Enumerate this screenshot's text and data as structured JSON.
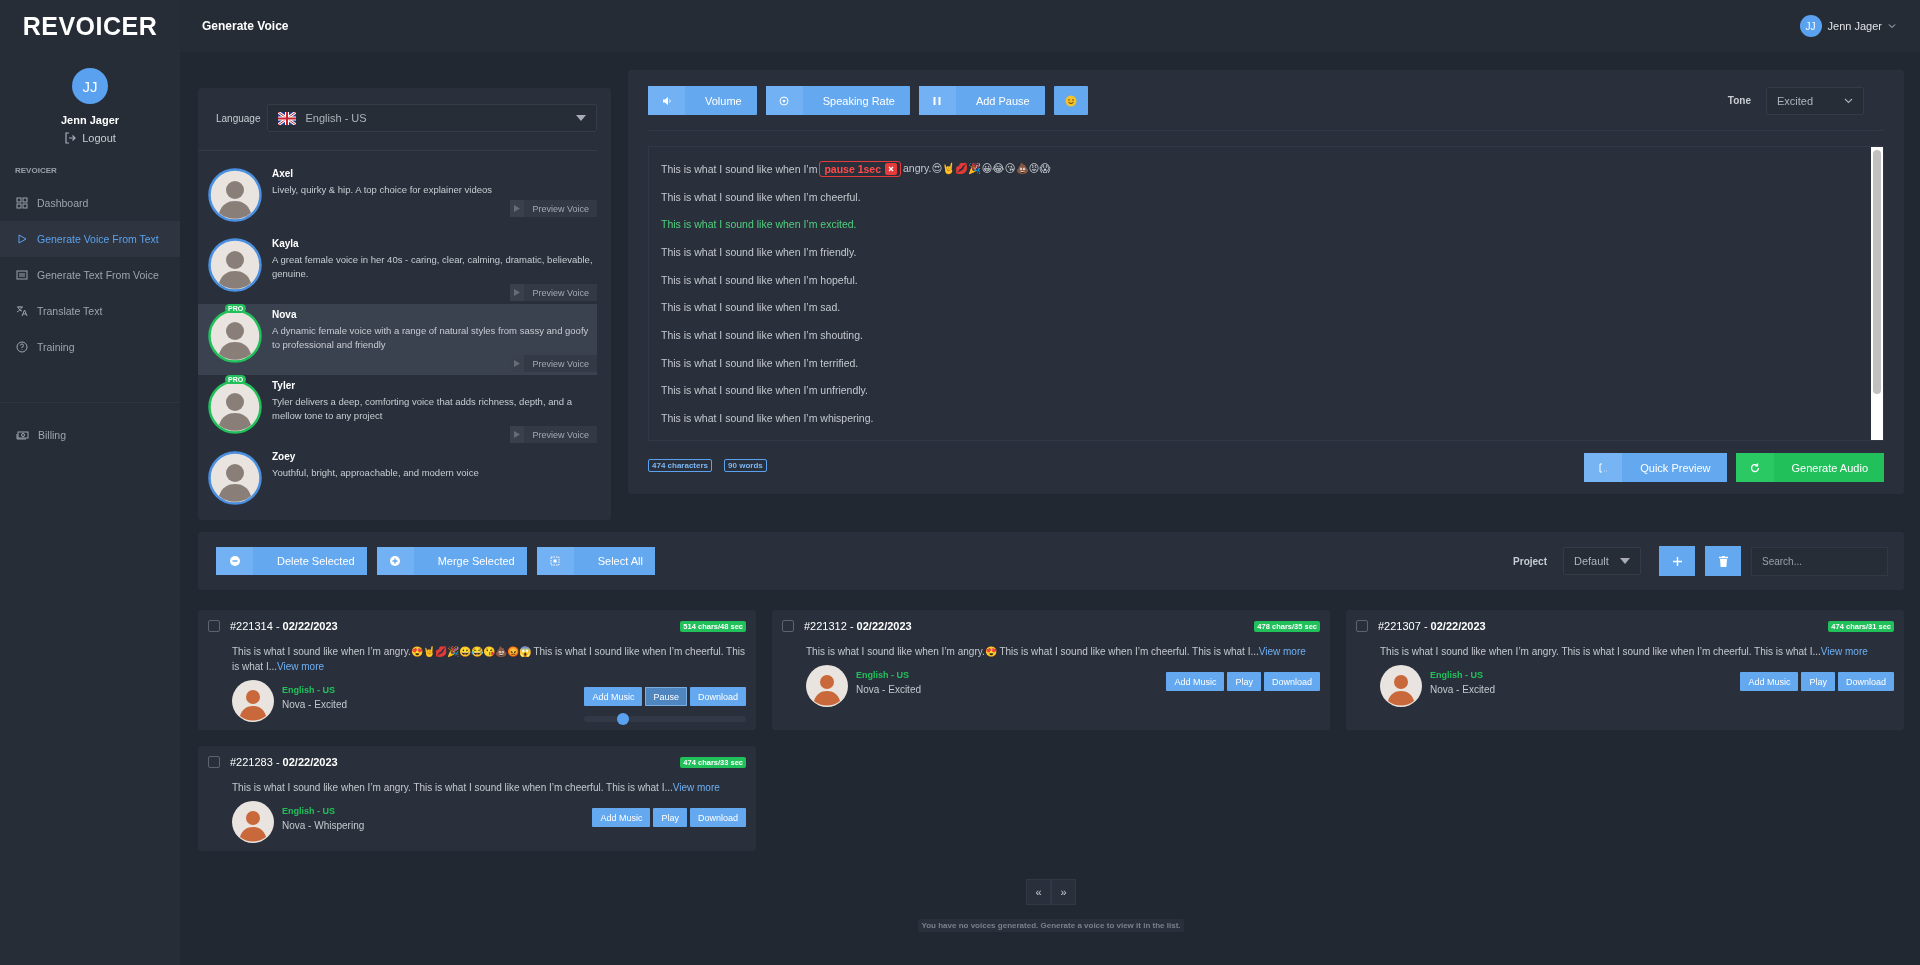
{
  "logo": "REVOICER",
  "header": {
    "title": "Generate Voice",
    "user": {
      "initials": "JJ",
      "name": "Jenn Jager"
    }
  },
  "sidebar": {
    "profile": {
      "initials": "JJ",
      "name": "Jenn Jager",
      "logout": "Logout"
    },
    "section": "REVOICER",
    "items": [
      {
        "label": "Dashboard",
        "selected": false
      },
      {
        "label": "Generate Voice From Text",
        "selected": true
      },
      {
        "label": "Generate Text From Voice",
        "selected": false
      },
      {
        "label": "Translate Text",
        "selected": false
      },
      {
        "label": "Training",
        "selected": false
      },
      {
        "label": "Billing",
        "selected": false
      }
    ]
  },
  "voices_panel": {
    "language_label": "Language",
    "language": "English - US",
    "voices": [
      {
        "name": "Axel",
        "description": "Lively, quirky & hip. A top choice for explainer videos",
        "selected": false,
        "preview": "Preview Voice"
      },
      {
        "name": "Kayla",
        "description": "A great female voice in her 40s - caring, clear, calming, dramatic, believable, genuine.",
        "selected": false,
        "preview": "Preview Voice"
      },
      {
        "name": "Nova",
        "description": "A dynamic female voice with a range of natural styles from sassy and goofy to professional and friendly",
        "badge": "PRO",
        "selected": true,
        "preview": "Preview Voice"
      },
      {
        "name": "Tyler",
        "description": "Tyler delivers a deep, comforting voice that adds richness, depth, and a mellow tone to any project",
        "badge": "PRO",
        "selected": false,
        "preview": "Preview Voice"
      },
      {
        "name": "Zoey",
        "description": "Youthful, bright, approachable, and modern voice",
        "selected": false
      }
    ]
  },
  "editor": {
    "toolbar": [
      "Volume",
      "Speaking Rate",
      "Add Pause"
    ],
    "tone_label": "Tone",
    "tone": "Excited",
    "lines": [
      {
        "highlighted": false,
        "parts": [
          {
            "kind": "text",
            "text": "This is what I sound like when I’m"
          },
          {
            "kind": "pause",
            "text": "pause 1sec"
          },
          {
            "kind": "text",
            "text": "angry.😍🤘💋🎉😀😂😘💩😡😱"
          }
        ]
      },
      {
        "highlighted": false,
        "parts": [
          {
            "kind": "text",
            "text": "This is what I sound like when I’m cheerful."
          }
        ]
      },
      {
        "highlighted": true,
        "parts": [
          {
            "kind": "text",
            "text": "This is what I sound like when I’m excited."
          }
        ]
      },
      {
        "highlighted": false,
        "parts": [
          {
            "kind": "text",
            "text": "This is what I sound like when I’m friendly."
          }
        ]
      },
      {
        "highlighted": false,
        "parts": [
          {
            "kind": "text",
            "text": "This is what I sound like when I’m hopeful."
          }
        ]
      },
      {
        "highlighted": false,
        "parts": [
          {
            "kind": "text",
            "text": "This is what I sound like when I’m sad."
          }
        ]
      },
      {
        "highlighted": false,
        "parts": [
          {
            "kind": "text",
            "text": "This is what I sound like when I’m shouting."
          }
        ]
      },
      {
        "highlighted": false,
        "parts": [
          {
            "kind": "text",
            "text": "This is what I sound like when I’m terrified."
          }
        ]
      },
      {
        "highlighted": false,
        "parts": [
          {
            "kind": "text",
            "text": "This is what I sound like when I’m unfriendly."
          }
        ]
      },
      {
        "highlighted": false,
        "parts": [
          {
            "kind": "text",
            "text": "This is what I sound like when I’m whispering."
          }
        ]
      }
    ],
    "characters": "474 characters",
    "words": "90 words",
    "quick_preview": "Quick Preview",
    "generate": "Generate Audio"
  },
  "actions": {
    "delete": "Delete Selected",
    "merge": "Merge Selected",
    "select_all": "Select All",
    "project_label": "Project",
    "project": "Default",
    "search": {
      "placeholder": "Search..."
    }
  },
  "cards": [
    {
      "title": "#221314 - **02/22/2023**",
      "badge": "514 chars/48 sec",
      "checked": false,
      "text": "This is what I sound like when I’m angry.😍🤘💋🎉😀😂😘💩😡😱 This is what I sound like when I’m cheerful. This is what I...",
      "more": "View more",
      "language": "English - US",
      "voice": "Nova - Excited",
      "buttons": [
        {
          "label": "Add Music",
          "pressed": false
        },
        {
          "label": "Pause",
          "pressed": true
        },
        {
          "label": "Download",
          "pressed": false
        }
      ],
      "player": {
        "level": 0.24
      }
    },
    {
      "title": "#221312 - **02/22/2023**",
      "badge": "478 chars/35 sec",
      "checked": false,
      "text": "This is what I sound like when I’m angry.😍 This is what I sound like when I’m cheerful. This is what I...",
      "more": "View more",
      "language": "English - US",
      "voice": "Nova - Excited",
      "buttons": [
        {
          "label": "Add Music",
          "pressed": false
        },
        {
          "label": "Play",
          "pressed": false
        },
        {
          "label": "Download",
          "pressed": false
        }
      ]
    },
    {
      "title": "#221307 - **02/22/2023**",
      "badge": "474 chars/31 sec",
      "checked": false,
      "text": "This is what I sound like when I’m angry. This is what I sound like when I’m cheerful. This is what I...",
      "more": "View more",
      "language": "English - US",
      "voice": "Nova - Excited",
      "buttons": [
        {
          "label": "Add Music",
          "pressed": false
        },
        {
          "label": "Play",
          "pressed": false
        },
        {
          "label": "Download",
          "pressed": false
        }
      ]
    },
    {
      "title": "#221283 - **02/22/2023**",
      "badge": "474 chars/33 sec",
      "checked": false,
      "text": "This is what I sound like when I’m angry. This is what I sound like when I’m cheerful. This is what I...",
      "more": "View more",
      "language": "English - US",
      "voice": "Nova - Whispering",
      "buttons": [
        {
          "label": "Add Music",
          "pressed": false
        },
        {
          "label": "Play",
          "pressed": false
        },
        {
          "label": "Download",
          "pressed": false
        }
      ]
    }
  ],
  "pagination": {
    "prev": "«",
    "next": "»"
  },
  "empty_message": "You have no voices generated. Generate a voice to view it in the list."
}
